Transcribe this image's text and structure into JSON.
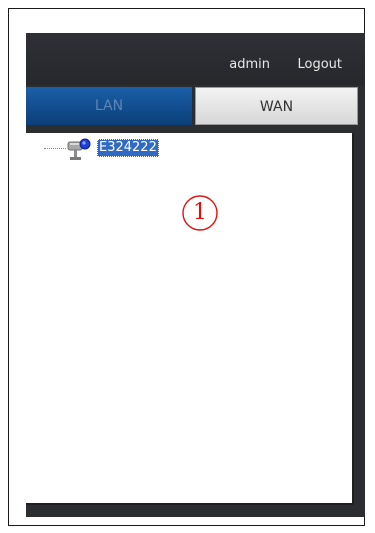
{
  "header": {
    "user": "admin",
    "logout_label": "Logout"
  },
  "tabs": [
    {
      "label": "LAN",
      "active": false
    },
    {
      "label": "WAN",
      "active": true
    }
  ],
  "tree": {
    "nodes": [
      {
        "label": "E324222",
        "icon": "camera-icon",
        "selected": true
      }
    ]
  },
  "annotation": {
    "marker": "1"
  },
  "colors": {
    "app_background": "#2b2d31",
    "lan_tab": "#0c3f79",
    "wan_tab": "#d7d7d7",
    "selection": "#316ac5",
    "annotation": "#e01010"
  }
}
